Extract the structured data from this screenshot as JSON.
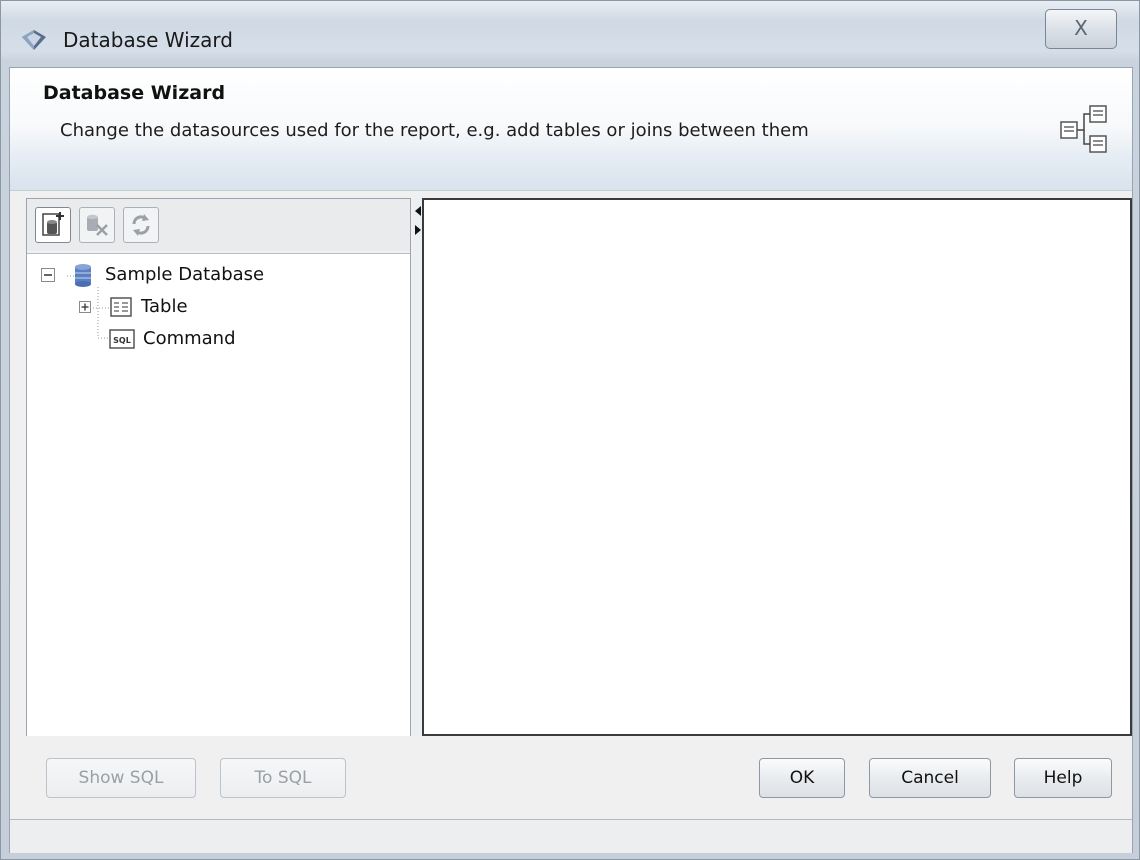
{
  "window": {
    "title": "Database Wizard",
    "close_label": "X"
  },
  "header": {
    "title": "Database Wizard",
    "description": "Change the datasources used for the report, e.g. add tables or joins between them"
  },
  "toolbar": {
    "buttons": [
      {
        "name": "add-datasource-icon",
        "enabled": true
      },
      {
        "name": "remove-datasource-icon",
        "enabled": false
      },
      {
        "name": "refresh-icon",
        "enabled": false
      }
    ]
  },
  "tree": {
    "root": {
      "label": "Sample Database",
      "icon": "database-icon",
      "expanded": true
    },
    "children": [
      {
        "label": "Table",
        "icon": "table-icon",
        "expandable": true
      },
      {
        "label": "Command",
        "icon": "sql-icon",
        "badge": "SQL"
      }
    ]
  },
  "buttons": {
    "show_sql": "Show SQL",
    "to_sql": "To SQL",
    "ok": "OK",
    "cancel": "Cancel",
    "help": "Help"
  },
  "colors": {
    "accent_blue": "#4a70b4",
    "panel_border": "#3b3b3b"
  }
}
